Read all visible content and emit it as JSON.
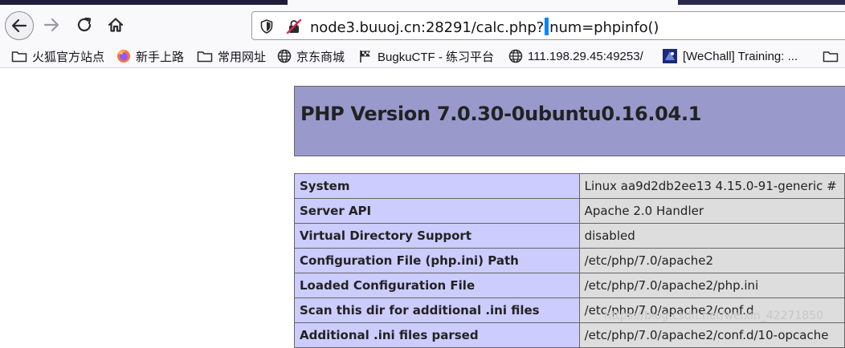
{
  "browser": {
    "url_prefix": "node3.buuoj.cn:28291/calc.php?",
    "url_suffix": "num=phpinfo()",
    "icons": {
      "back": "back-arrow-icon",
      "forward": "forward-arrow-icon",
      "reload": "reload-icon",
      "home": "home-icon",
      "shield": "shield-icon",
      "insecure": "insecure-lock-icon"
    }
  },
  "bookmarks": [
    {
      "label": "火狐官方站点",
      "icon": "folder-icon"
    },
    {
      "label": "新手上路",
      "icon": "firefox-icon"
    },
    {
      "label": "常用网址",
      "icon": "folder-icon"
    },
    {
      "label": "京东商城",
      "icon": "globe-icon"
    },
    {
      "label": "BugkuCTF - 练习平台",
      "icon": "flag-icon"
    },
    {
      "label": "111.198.29.45:49253/",
      "icon": "globe-icon"
    },
    {
      "label": "[WeChall] Training: ...",
      "icon": "wechall-icon"
    },
    {
      "label": "",
      "icon": "folder-icon"
    }
  ],
  "page": {
    "title": "PHP Version 7.0.30-0ubuntu0.16.04.1",
    "rows": [
      {
        "key": "System",
        "value": "Linux aa9d2db2ee13 4.15.0-91-generic #"
      },
      {
        "key": "Server API",
        "value": "Apache 2.0 Handler"
      },
      {
        "key": "Virtual Directory Support",
        "value": "disabled"
      },
      {
        "key": "Configuration File (php.ini) Path",
        "value": "/etc/php/7.0/apache2"
      },
      {
        "key": "Loaded Configuration File",
        "value": "/etc/php/7.0/apache2/php.ini"
      },
      {
        "key": "Scan this dir for additional .ini files",
        "value": "/etc/php/7.0/apache2/conf.d"
      },
      {
        "key": "Additional .ini files parsed",
        "value": "/etc/php/7.0/apache2/conf.d/10-opcache"
      }
    ],
    "watermark": "https://blog.csdn.net/weixin_42271850"
  },
  "colors": {
    "header_bg": "#9999cc",
    "key_bg": "#ccccff",
    "value_bg": "#dddddd",
    "url_highlight": "#0a84ff"
  }
}
